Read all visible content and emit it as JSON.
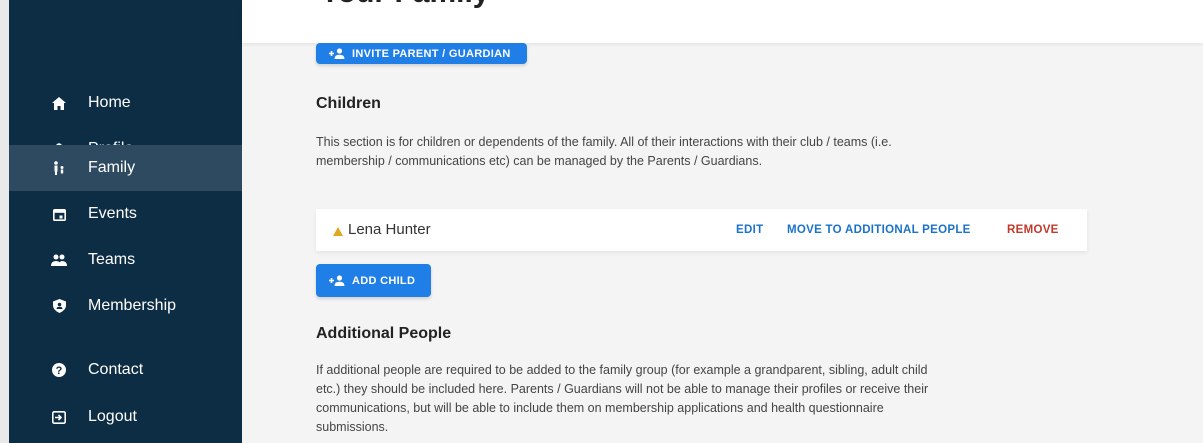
{
  "header": {
    "title": "Your Family"
  },
  "nav": {
    "items": [
      {
        "label": "Home",
        "icon": "home-icon"
      },
      {
        "label": "Profile",
        "icon": "person-icon"
      },
      {
        "label": "Family",
        "icon": "family-icon",
        "active": true
      },
      {
        "label": "Events",
        "icon": "calendar-icon"
      },
      {
        "label": "Teams",
        "icon": "group-icon"
      },
      {
        "label": "Membership",
        "icon": "shield-icon"
      },
      {
        "label": "Contact",
        "icon": "help-circle-icon"
      },
      {
        "label": "Logout",
        "icon": "logout-icon"
      }
    ]
  },
  "parents": {
    "invite_label": "INVITE PARENT / GUARDIAN"
  },
  "children": {
    "heading": "Children",
    "description_line1": "This section is for children or dependents of the family. All of their interactions with their club / teams (i.e.",
    "description_line2": "membership / communications etc) can be managed by the Parents / Guardians.",
    "items": [
      {
        "name": "Lena Hunter",
        "edit": "EDIT",
        "move": "MOVE TO ADDITIONAL PEOPLE",
        "remove": "REMOVE"
      }
    ],
    "add_label": "ADD CHILD"
  },
  "additional": {
    "heading": "Additional People",
    "description_line1": "If additional people are required to be added to the family group (for example a grandparent, sibling, adult child",
    "description_line2": "etc.) they should be included here. Parents / Guardians will not be able to manage their profiles or receive their",
    "description_line3": "communications, but will be able to include them on membership applications and health questionnaire",
    "description_line4": "submissions."
  },
  "colors": {
    "sidebar": "#0d2d44",
    "active": "#2e4a60",
    "primary": "#1f7fe6",
    "action": "#1a73c9",
    "danger": "#c0392b",
    "warning": "#e0a822"
  }
}
